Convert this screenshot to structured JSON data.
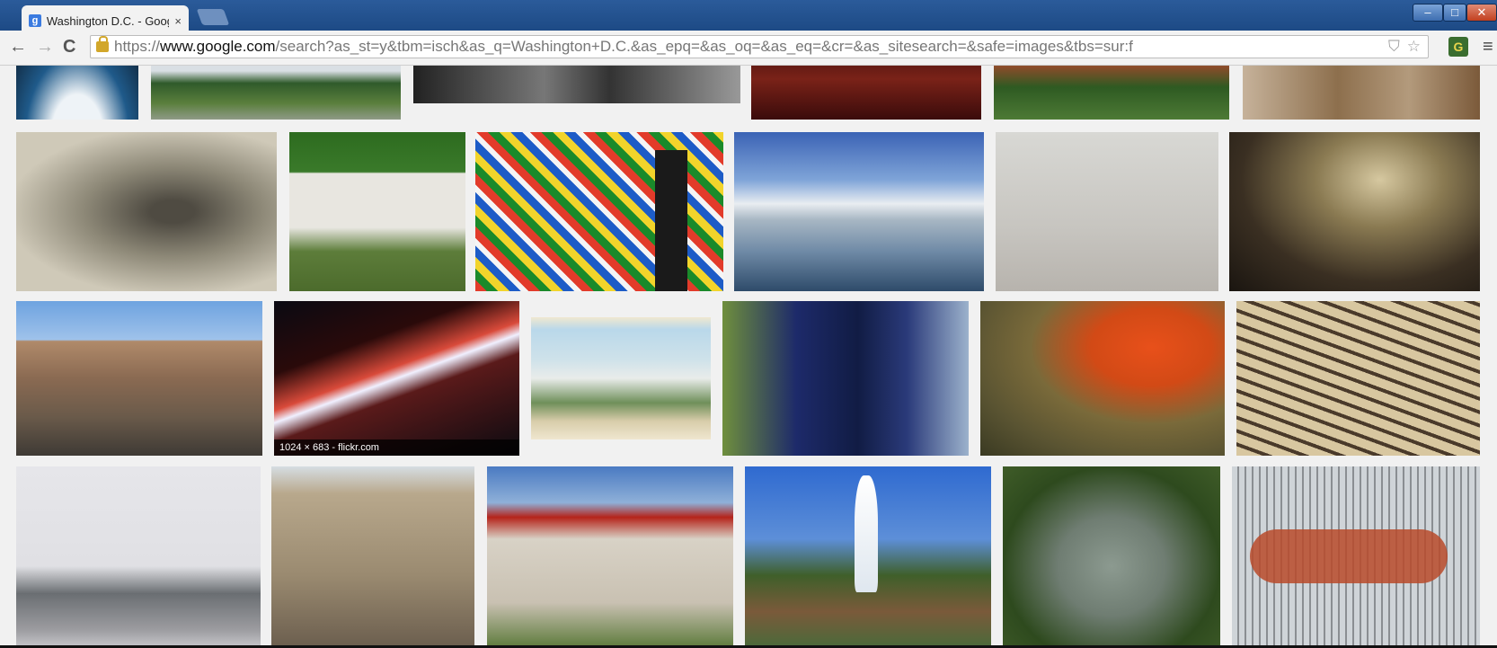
{
  "window": {
    "tab_title": "Washington D.C. - Google",
    "tab_close": "×",
    "tab_favicon": "g",
    "controls": {
      "minimize": "–",
      "maximize": "□",
      "close": "✕"
    }
  },
  "toolbar": {
    "back": "←",
    "forward": "→",
    "reload": "C",
    "url_scheme": "https://",
    "url_host": "www.google.com",
    "url_path": "/search?as_st=y&tbm=isch&as_q=Washington+D.C.&as_epq=&as_oq=&as_eq=&cr=&as_sitesearch=&safe=images&tbs=sur:f",
    "star_icon": "☆",
    "shield_icon": "⛉",
    "menu": "≡"
  },
  "images": {
    "caption_6": "1024 × 683 - flickr.com"
  },
  "icons": [
    "lock-icon",
    "back-arrow-icon",
    "forward-arrow-icon",
    "reload-icon",
    "star-icon",
    "shield-icon",
    "extension-icon",
    "menu-icon",
    "close-icon"
  ]
}
